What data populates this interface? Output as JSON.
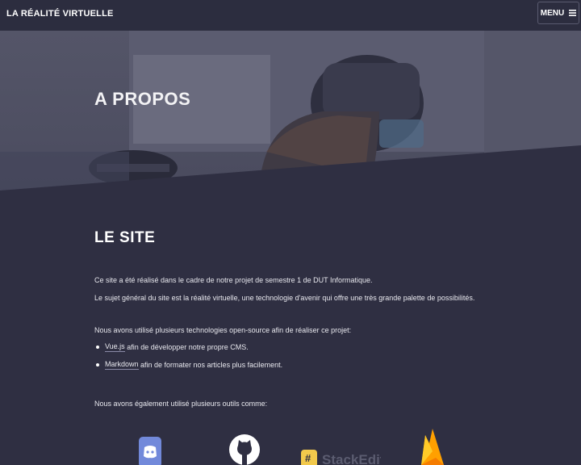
{
  "header": {
    "brand": "LA RÉALITÉ VIRTUELLE",
    "menu_label": "MENU"
  },
  "hero": {
    "title": "A PROPOS"
  },
  "site_section": {
    "title": "LE SITE",
    "intro_line1": "Ce site a été réalisé dans le cadre de notre projet de semestre 1 de DUT Informatique.",
    "intro_line2": "Le sujet général du site est la réalité virtuelle, une technologie d'avenir qui offre une très grande palette de possibilités.",
    "tech_intro": "Nous avons utilisé plusieurs technologies open-source afin de réaliser ce projet:",
    "tech_items": [
      {
        "link": "Vue.js",
        "text": " afin de développer notre propre CMS."
      },
      {
        "link": "Markdown",
        "text": " afin de formater nos articles plus facilement."
      }
    ],
    "tools_intro": "Nous avons également utilisé plusieurs outils comme:",
    "tools": [
      {
        "name": "discord-icon"
      },
      {
        "name": "github-icon"
      },
      {
        "name": "stackedit-icon",
        "label": "StackEdit"
      },
      {
        "name": "firebase-icon"
      }
    ]
  },
  "colors": {
    "background": "#2f2f42",
    "header": "#2c2d3f",
    "discord": "#7289da",
    "stackedit": "#f2c94c",
    "firebase": "#ffa000"
  }
}
